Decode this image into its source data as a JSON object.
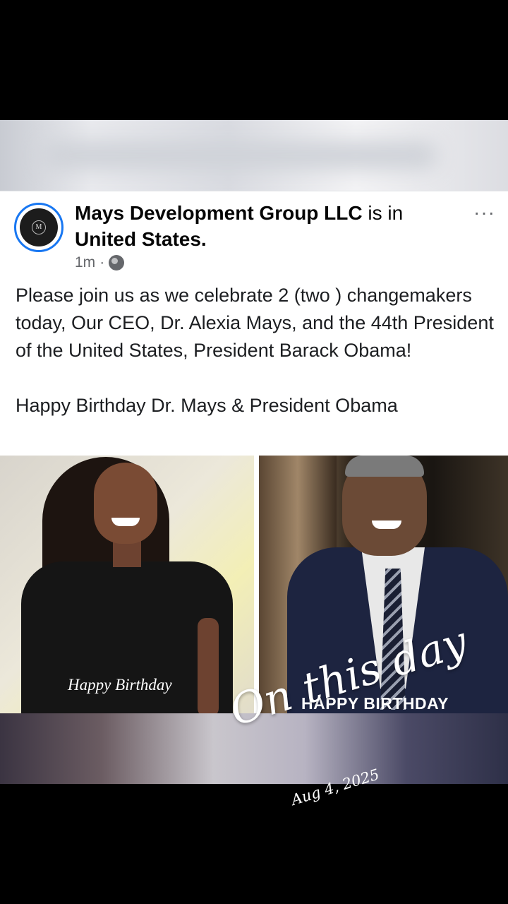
{
  "post": {
    "author": "Mays Development Group LLC",
    "connector": " is in",
    "location": "United States.",
    "time": "1m",
    "separator": "·",
    "body": "Please join us as we celebrate 2 (two ) changemakers today, Our CEO, Dr. Alexia Mays, and the 44th President of the United States, President Barack Obama!\n\nHappy Birthday Dr. Mays & President Obama",
    "more": "···"
  },
  "photos": {
    "left_caption": "Happy Birthday",
    "right_caption": "HAPPY BIRTHDAY"
  },
  "overlay": {
    "title": "On this day",
    "date": "Aug 4, 2025"
  },
  "colors": {
    "accent": "#1877f2",
    "meta": "#65676b"
  },
  "icons": {
    "globe": "globe-icon",
    "more": "more-options-icon"
  }
}
